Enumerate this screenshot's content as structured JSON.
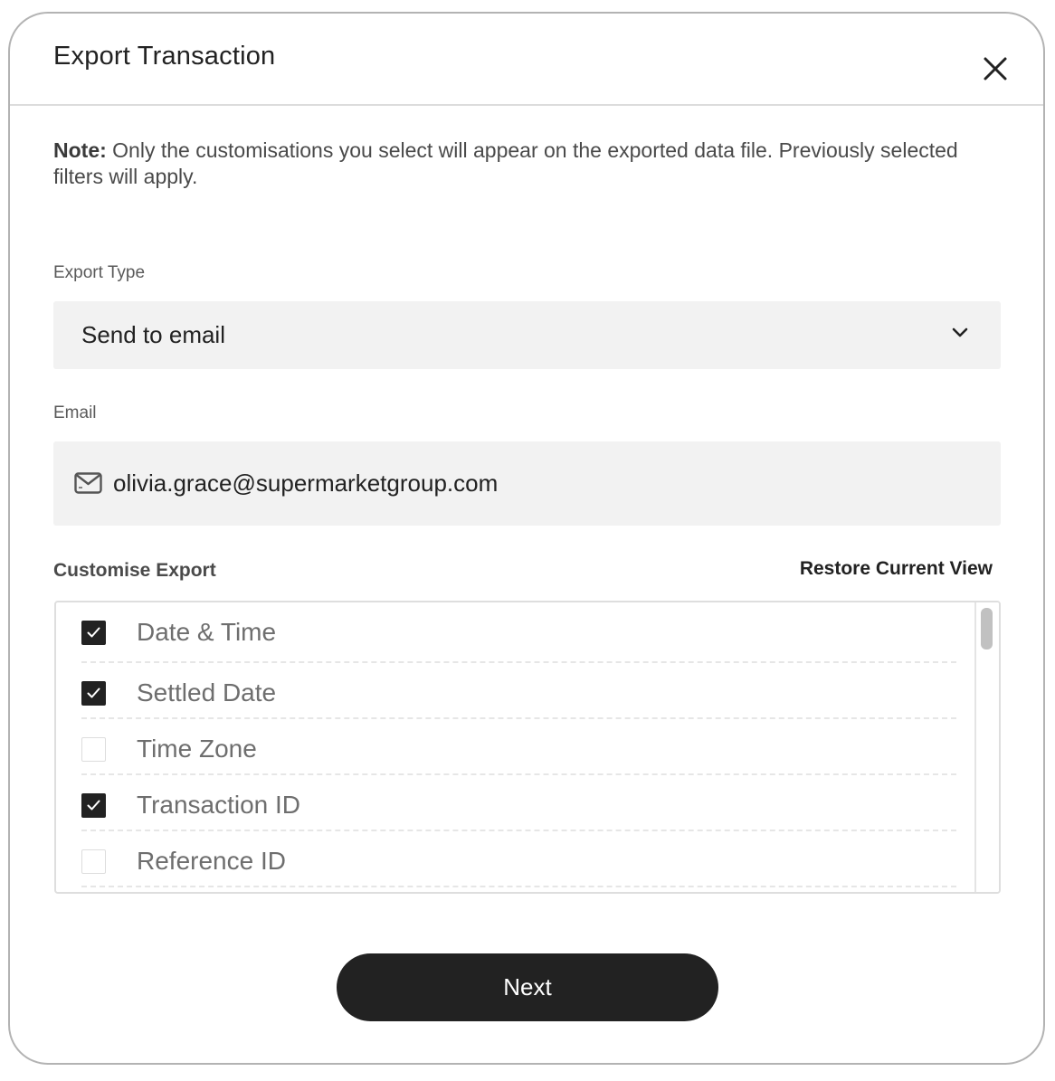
{
  "dialog": {
    "title": "Export Transaction"
  },
  "note": {
    "prefix": "Note:",
    "text": " Only the customisations you select will appear on the exported data file. Previously selected filters will apply."
  },
  "export_type": {
    "label": "Export Type",
    "selected": "Send to email"
  },
  "email": {
    "label": "Email",
    "value": "olivia.grace@supermarketgroup.com"
  },
  "customise": {
    "label": "Customise Export",
    "restore_label": "Restore Current View",
    "items": [
      {
        "label": "Date & Time",
        "checked": true
      },
      {
        "label": "Settled Date",
        "checked": true
      },
      {
        "label": "Time Zone",
        "checked": false
      },
      {
        "label": "Transaction ID",
        "checked": true
      },
      {
        "label": "Reference ID",
        "checked": false
      }
    ]
  },
  "actions": {
    "next_label": "Next"
  },
  "icons": {
    "close": "close-icon",
    "dropdown": "chevron-down-icon",
    "email": "mail-icon",
    "check": "checkmark-icon"
  },
  "colors": {
    "primary": "#222222",
    "field_bg": "#f2f2f2"
  }
}
